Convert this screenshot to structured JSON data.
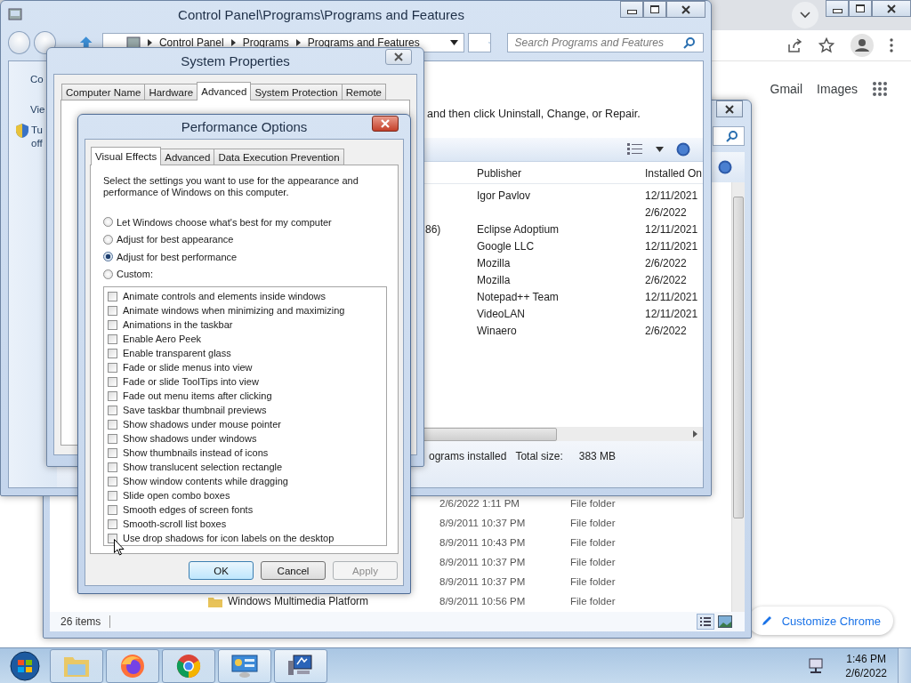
{
  "browser": {
    "top_links": [
      "Gmail",
      "Images"
    ],
    "customize_button": "Customize Chrome"
  },
  "explorer": {
    "rows": [
      {
        "date": "2/6/2022 1:11 PM",
        "type": "File folder"
      },
      {
        "date": "8/9/2011 10:37 PM",
        "type": "File folder"
      },
      {
        "date": "8/9/2011 10:43 PM",
        "type": "File folder"
      },
      {
        "date": "8/9/2011 10:37 PM",
        "type": "File folder"
      },
      {
        "date": "8/9/2011 10:37 PM",
        "type": "File folder"
      },
      {
        "name": "Windows Multimedia Platform",
        "date": "8/9/2011 10:56 PM",
        "type": "File folder"
      }
    ],
    "status": "26 items"
  },
  "programs_window": {
    "title": "Control Panel\\Programs\\Programs and Features",
    "breadcrumb": [
      "Control Panel",
      "Programs",
      "Programs and Features"
    ],
    "search": {
      "placeholder": "Search Programs and Features"
    },
    "left_pane": [
      "Co",
      "Vie",
      "Tu",
      "off"
    ],
    "instruction": "and then click Uninstall, Change, or Repair.",
    "columns": [
      "Publisher",
      "Installed On"
    ],
    "rows": [
      {
        "publisher": "Igor Pavlov",
        "installed_on": "12/11/2021"
      },
      {
        "installed_on": "2/6/2022"
      },
      {
        "name": "86)",
        "publisher": "Eclipse Adoptium",
        "installed_on": "12/11/2021"
      },
      {
        "publisher": "Google LLC",
        "installed_on": "12/11/2021"
      },
      {
        "publisher": "Mozilla",
        "installed_on": "2/6/2022"
      },
      {
        "publisher": "Mozilla",
        "installed_on": "2/6/2022"
      },
      {
        "publisher": "Notepad++ Team",
        "installed_on": "12/11/2021"
      },
      {
        "publisher": "VideoLAN",
        "installed_on": "12/11/2021"
      },
      {
        "publisher": "Winaero",
        "installed_on": "2/6/2022"
      }
    ],
    "status": [
      "ograms installed",
      "Total size:",
      "383 MB"
    ]
  },
  "system_properties": {
    "title": "System Properties",
    "tabs": [
      {
        "label": "Computer Name",
        "selected": false
      },
      {
        "label": "Hardware",
        "selected": false
      },
      {
        "label": "Advanced",
        "selected": true
      },
      {
        "label": "System Protection",
        "selected": false
      },
      {
        "label": "Remote",
        "selected": false
      }
    ]
  },
  "performance_options": {
    "title": "Performance Options",
    "tabs": [
      {
        "label": "Visual Effects",
        "selected": true
      },
      {
        "label": "Advanced",
        "selected": false
      },
      {
        "label": "Data Execution Prevention",
        "selected": false
      }
    ],
    "description": "Select the settings you want to use for the appearance and performance of Windows on this computer.",
    "radios": [
      {
        "label": "Let Windows choose what's best for my computer",
        "selected": false
      },
      {
        "label": "Adjust for best appearance",
        "selected": false
      },
      {
        "label": "Adjust for best performance",
        "selected": true
      },
      {
        "label": "Custom:",
        "selected": false
      }
    ],
    "effects": [
      {
        "label": "Animate controls and elements inside windows",
        "checked": false
      },
      {
        "label": "Animate windows when minimizing and maximizing",
        "checked": false
      },
      {
        "label": "Animations in the taskbar",
        "checked": false
      },
      {
        "label": "Enable Aero Peek",
        "checked": false
      },
      {
        "label": "Enable transparent glass",
        "checked": false
      },
      {
        "label": "Fade or slide menus into view",
        "checked": false
      },
      {
        "label": "Fade or slide ToolTips into view",
        "checked": false
      },
      {
        "label": "Fade out menu items after clicking",
        "checked": false
      },
      {
        "label": "Save taskbar thumbnail previews",
        "checked": false
      },
      {
        "label": "Show shadows under mouse pointer",
        "checked": false
      },
      {
        "label": "Show shadows under windows",
        "checked": false
      },
      {
        "label": "Show thumbnails instead of icons",
        "checked": false
      },
      {
        "label": "Show translucent selection rectangle",
        "checked": false
      },
      {
        "label": "Show window contents while dragging",
        "checked": false
      },
      {
        "label": "Slide open combo boxes",
        "checked": false
      },
      {
        "label": "Smooth edges of screen fonts",
        "checked": false
      },
      {
        "label": "Smooth-scroll list boxes",
        "checked": false
      },
      {
        "label": "Use drop shadows for icon labels on the desktop",
        "checked": false
      }
    ],
    "buttons": [
      {
        "label": "OK",
        "default": true,
        "disabled": false
      },
      {
        "label": "Cancel",
        "default": false,
        "disabled": false
      },
      {
        "label": "Apply",
        "default": false,
        "disabled": true
      }
    ]
  },
  "clock": {
    "time": "1:46 PM",
    "date": "2/6/2022"
  }
}
